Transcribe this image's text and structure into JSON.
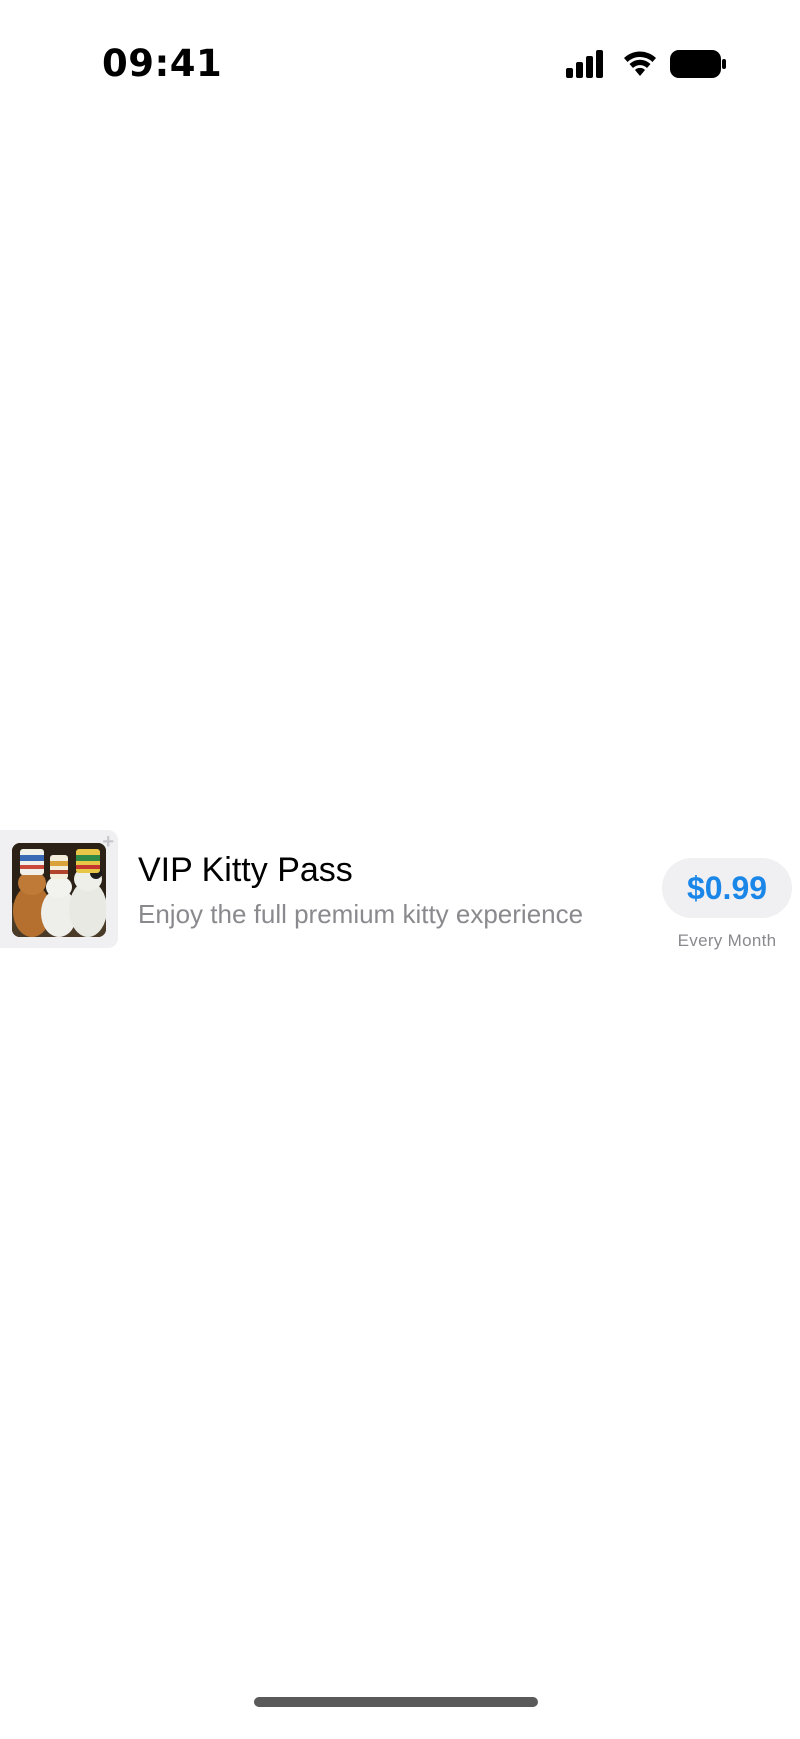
{
  "status_bar": {
    "time": "09:41",
    "icons": [
      "signal-icon",
      "wifi-icon",
      "battery-icon"
    ]
  },
  "subscription": {
    "thumbnail": "cats-with-cup-hats-image",
    "title": "VIP Kitty Pass",
    "description": "Enjoy the full premium kitty experience",
    "price": "$0.99",
    "period": "Every Month"
  },
  "colors": {
    "accent": "#1a86e8",
    "secondary_text": "#8a8a8e",
    "chip_background": "#f0f0f3"
  }
}
